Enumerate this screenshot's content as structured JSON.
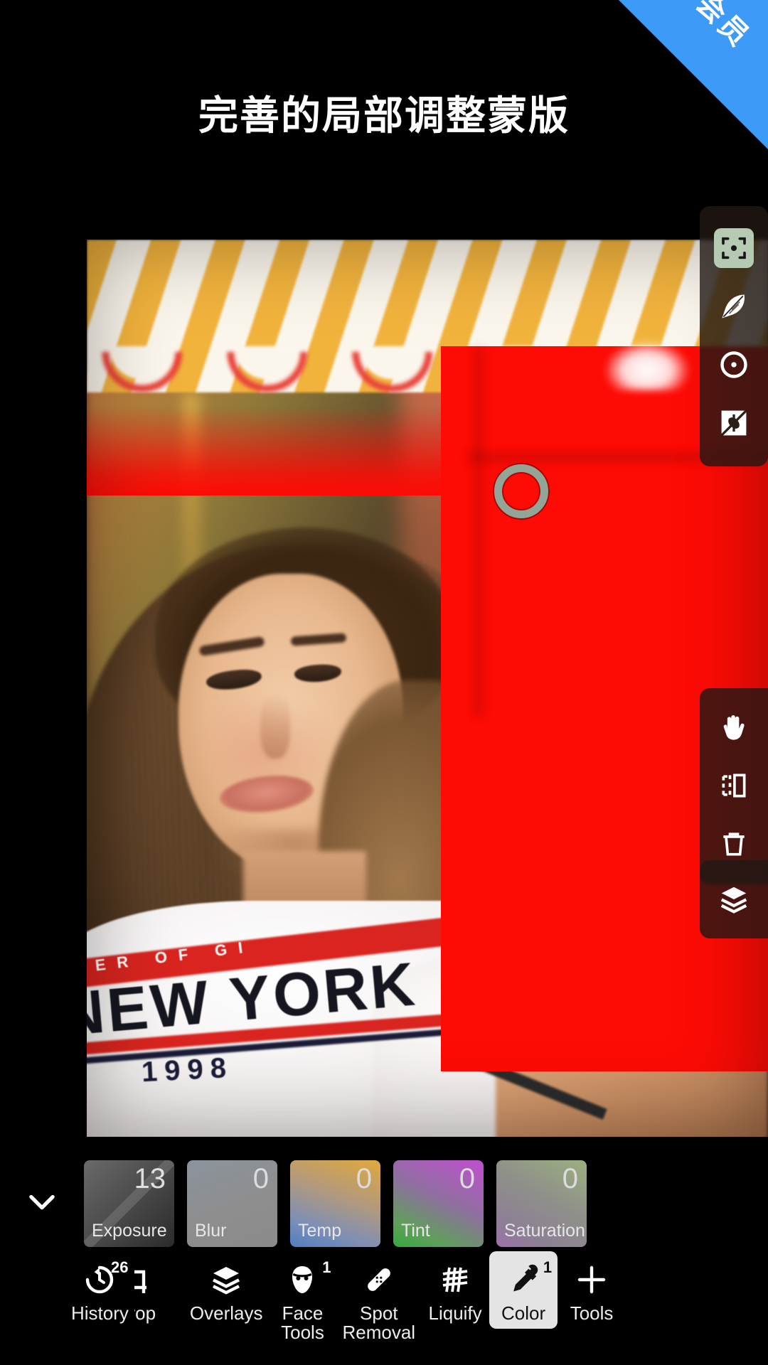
{
  "ribbon": {
    "label": "会员"
  },
  "headline": {
    "text": "完善的局部调整蒙版"
  },
  "canvas": {
    "shirt_text_small": "ER OF GI",
    "shirt_text_main": "NEW YORK",
    "shirt_year": "1998",
    "brush_cursor": "brush-cursor-ring",
    "mask_color": "#fd0b05"
  },
  "mask_tools": {
    "items": [
      {
        "name": "selection-target",
        "label": "Selection",
        "selected": true
      },
      {
        "name": "feather",
        "label": "Feather",
        "selected": false
      },
      {
        "name": "radial",
        "label": "Radial",
        "selected": false
      },
      {
        "name": "invert",
        "label": "Invert",
        "selected": false
      }
    ]
  },
  "transform_tools": {
    "items": [
      {
        "name": "pan-hand",
        "label": "Pan"
      },
      {
        "name": "flip-mirror",
        "label": "Flip"
      },
      {
        "name": "delete-trash",
        "label": "Delete"
      }
    ]
  },
  "layers_panel": {
    "name": "layers",
    "label": "Layers"
  },
  "adjustments": {
    "collapse_label": "Collapse",
    "items": [
      {
        "label": "Exposure",
        "value": "13",
        "selected": true
      },
      {
        "label": "Blur",
        "value": "0",
        "selected": false
      },
      {
        "label": "Temp",
        "value": "0",
        "selected": false
      },
      {
        "label": "Tint",
        "value": "0",
        "selected": false
      },
      {
        "label": "Saturation",
        "value": "0",
        "selected": false
      }
    ]
  },
  "bottom_toolbar": {
    "items": [
      {
        "label": "History",
        "icon": "history-icon",
        "badge": "26",
        "active": false
      },
      {
        "label": "Crop",
        "icon": "crop-icon",
        "badge": "",
        "active": false
      },
      {
        "label": "Overlays",
        "icon": "layers-icon",
        "badge": "",
        "active": false
      },
      {
        "label": "Face\nTools",
        "icon": "face-icon",
        "badge": "1",
        "active": false
      },
      {
        "label": "Spot\nRemoval",
        "icon": "bandage-icon",
        "badge": "",
        "active": false
      },
      {
        "label": "Liquify",
        "icon": "liquify-grid-icon",
        "badge": "",
        "active": false
      },
      {
        "label": "Color",
        "icon": "eyedropper-icon",
        "badge": "1",
        "active": true
      },
      {
        "label": "Tools",
        "icon": "plus-icon",
        "badge": "",
        "active": false
      }
    ]
  }
}
